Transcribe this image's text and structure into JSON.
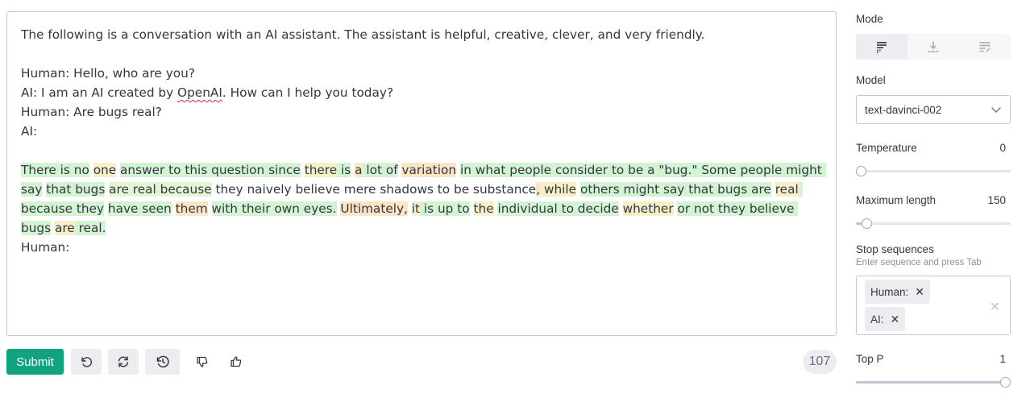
{
  "prompt": {
    "line1": "The following is a conversation with an AI assistant. The assistant is helpful, creative, clever, and very friendly.",
    "line2": "Human: Hello, who are you?",
    "line3a": "AI: I am an AI created by ",
    "line3b": "OpenAI",
    "line3c": ". How can I help you today?",
    "line4": "Human: Are bugs real?",
    "line5": "AI:"
  },
  "completion": {
    "segments": [
      {
        "t": "There is no",
        "c": "g"
      },
      {
        "t": " ",
        "c": ""
      },
      {
        "t": "one",
        "c": "y"
      },
      {
        "t": " ",
        "c": ""
      },
      {
        "t": "answer to this question since",
        "c": "g"
      },
      {
        "t": " ",
        "c": ""
      },
      {
        "t": "there",
        "c": "y"
      },
      {
        "t": " is",
        "c": "g"
      },
      {
        "t": " ",
        "c": ""
      },
      {
        "t": "a",
        "c": "o"
      },
      {
        "t": " lot of",
        "c": "g"
      },
      {
        "t": " ",
        "c": ""
      },
      {
        "t": "variation",
        "c": "o"
      },
      {
        "t": " ",
        "c": ""
      },
      {
        "t": "in what people consider to be a \"bug.\" Some people might say",
        "c": "g"
      },
      {
        "t": " ",
        "c": ""
      },
      {
        "t": "that bugs",
        "c": "g"
      },
      {
        "t": " ",
        "c": ""
      },
      {
        "t": "are real because",
        "c": "lg"
      },
      {
        "t": " they naively believe mere shadows to be substance",
        "c": ""
      },
      {
        "t": ",",
        "c": "o"
      },
      {
        "t": " while",
        "c": "y"
      },
      {
        "t": " ",
        "c": ""
      },
      {
        "t": "others might say that bugs are",
        "c": "g"
      },
      {
        "t": " ",
        "c": ""
      },
      {
        "t": "real",
        "c": "y"
      },
      {
        "t": " because they",
        "c": "g"
      },
      {
        "t": " ",
        "c": ""
      },
      {
        "t": "have seen",
        "c": "g"
      },
      {
        "t": " ",
        "c": ""
      },
      {
        "t": "them",
        "c": "o"
      },
      {
        "t": " ",
        "c": ""
      },
      {
        "t": "with their own eyes.",
        "c": "g"
      },
      {
        "t": " ",
        "c": ""
      },
      {
        "t": "Ultimately,",
        "c": "o"
      },
      {
        "t": " ",
        "c": ""
      },
      {
        "t": "it",
        "c": "y"
      },
      {
        "t": " is up to",
        "c": "g"
      },
      {
        "t": " ",
        "c": ""
      },
      {
        "t": "the",
        "c": "y"
      },
      {
        "t": " ",
        "c": ""
      },
      {
        "t": "individual to decide",
        "c": "g"
      },
      {
        "t": " ",
        "c": ""
      },
      {
        "t": "whether",
        "c": "y"
      },
      {
        "t": " ",
        "c": ""
      },
      {
        "t": "or not they believe bugs",
        "c": "g"
      },
      {
        "t": " ",
        "c": ""
      },
      {
        "t": "are",
        "c": "y"
      },
      {
        "t": " real.",
        "c": "g"
      }
    ],
    "footer": "Human:"
  },
  "toolbar": {
    "submit_label": "Submit",
    "undo_icon": "undo-icon",
    "regenerate_icon": "regenerate-icon",
    "history_icon": "history-icon",
    "thumbs_down_icon": "thumbs-down-icon",
    "thumbs_up_icon": "thumbs-up-icon",
    "token_count": "107"
  },
  "sidebar": {
    "mode_label": "Mode",
    "modes": [
      "complete-mode-icon",
      "insert-mode-icon",
      "edit-mode-icon"
    ],
    "model_label": "Model",
    "model_value": "text-davinci-002",
    "temperature_label": "Temperature",
    "temperature_value": "0",
    "temperature_level": 0,
    "max_length_label": "Maximum length",
    "max_length_value": "150",
    "max_length_level": 0.04,
    "stop_label": "Stop sequences",
    "stop_hint": "Enter sequence and press Tab",
    "stop_sequences": [
      "Human:",
      "AI:"
    ],
    "top_p_label": "Top P",
    "top_p_value": "1",
    "top_p_level": 1
  },
  "colors": {
    "accent": "#10a37f",
    "highlight_green": "#d2f4d3",
    "highlight_light_green": "#e3f5d2",
    "highlight_yellow": "#f5f0c8",
    "highlight_orange": "#fbe5c5"
  }
}
